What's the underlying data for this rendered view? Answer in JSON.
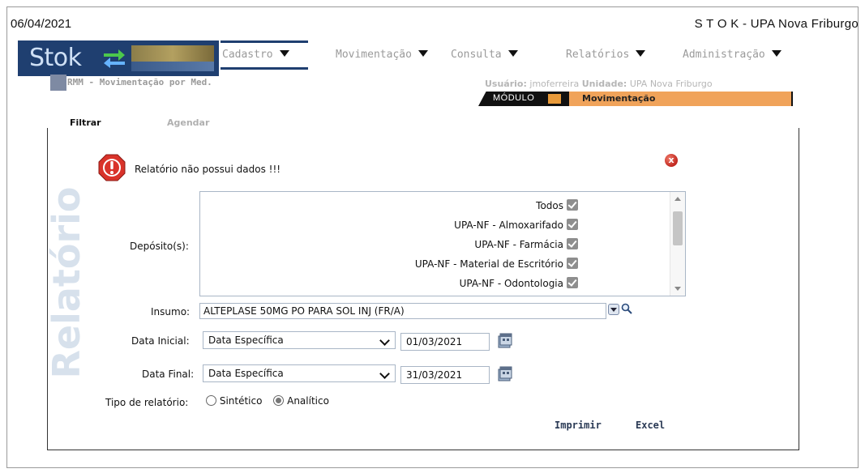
{
  "header": {
    "date": "06/04/2021",
    "title": "S T O K - UPA Nova Friburgo",
    "logo_text": "Stok"
  },
  "nav": {
    "items": [
      {
        "label": "Cadastro"
      },
      {
        "label": "Movimentação"
      },
      {
        "label": "Consulta"
      },
      {
        "label": "Relatórios"
      },
      {
        "label": "Administração"
      }
    ]
  },
  "subheader": {
    "screen_name": "RMM - Movimentação por Med.",
    "user_label": "Usuário:",
    "user_value": "jmoferreira",
    "unit_label": "Unidade:",
    "unit_value": "UPA Nova Friburgo",
    "module_label": "MÓDULO",
    "module_value": "Movimentação"
  },
  "tabs": {
    "filtrar": "Filtrar",
    "agendar": "Agendar"
  },
  "side_watermark": "Relatório",
  "alert": {
    "message": "Relatório não possui dados !!!"
  },
  "form": {
    "depositos_label": "Depósito(s):",
    "depositos": [
      {
        "label": "Todos",
        "checked": true
      },
      {
        "label": "UPA-NF - Almoxarifado",
        "checked": true
      },
      {
        "label": "UPA-NF - Farmácia",
        "checked": true
      },
      {
        "label": "UPA-NF - Material de Escritório",
        "checked": true
      },
      {
        "label": "UPA-NF - Odontologia",
        "checked": true
      }
    ],
    "insumo_label": "Insumo:",
    "insumo_value": "ALTEPLASE 50MG PO PARA SOL INJ (FR/A)",
    "data_inicial_label": "Data Inicial:",
    "data_inicial_mode": "Data Específica",
    "data_inicial_value": "01/03/2021",
    "data_final_label": "Data Final:",
    "data_final_mode": "Data Específica",
    "data_final_value": "31/03/2021",
    "tipo_label": "Tipo de relatório:",
    "tipo_options": [
      "Sintético",
      "Analítico"
    ],
    "tipo_selected": "Analítico"
  },
  "actions": {
    "imprimir": "Imprimir",
    "excel": "Excel"
  }
}
